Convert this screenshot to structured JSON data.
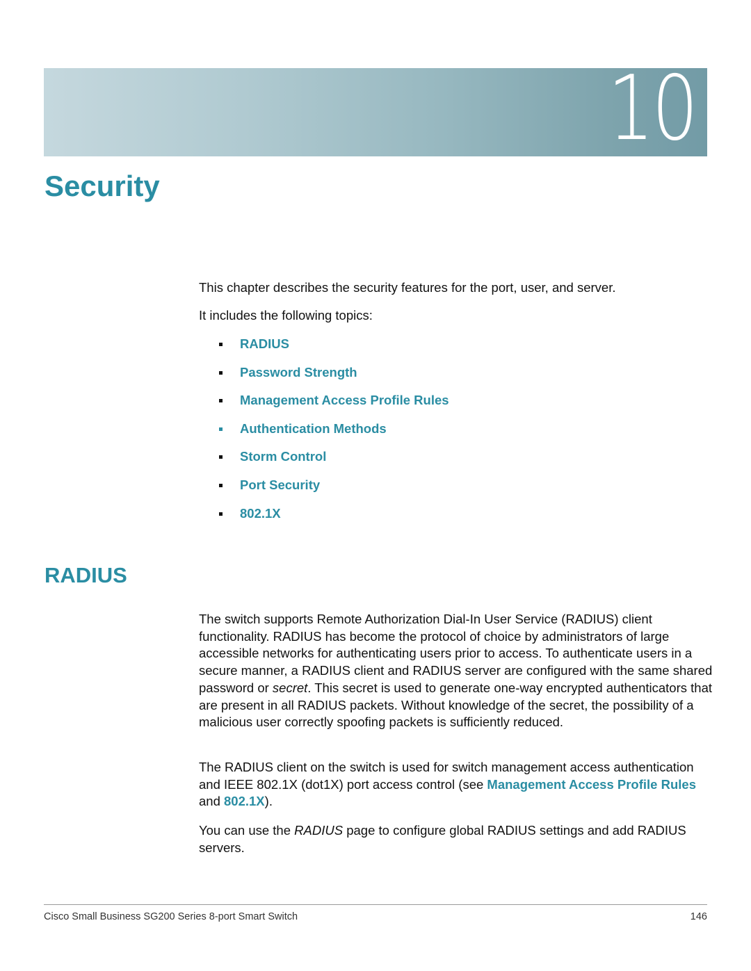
{
  "chapter": {
    "number": "10",
    "title": "Security"
  },
  "intro": {
    "line1": "This chapter describes the security features for the port, user, and server.",
    "line2": "It includes the following topics:"
  },
  "topics": [
    {
      "label": "RADIUS"
    },
    {
      "label": "Password Strength"
    },
    {
      "label": "Management Access Profile Rules"
    },
    {
      "label": "Authentication Methods"
    },
    {
      "label": "Storm Control"
    },
    {
      "label": "Port Security"
    },
    {
      "label": "802.1X"
    }
  ],
  "radius_section": {
    "heading": "RADIUS",
    "para1": {
      "before_italic": "The switch supports Remote Authorization Dial-In User Service (RADIUS) client functionality. RADIUS has become the protocol of choice by administrators of large accessible networks for authenticating users prior to access. To authenticate users in a secure manner, a RADIUS client and RADIUS server are configured with the same shared password or ",
      "italic": "secret",
      "after_italic": ". This secret is used to generate one-way encrypted authenticators that are present in all RADIUS packets. Without knowledge of the secret, the possibility of a malicious user correctly spoofing packets is sufficiently reduced."
    },
    "para2": {
      "before_link": "The RADIUS client on the switch is used for switch management access authentication and IEEE 802.1X (dot1X) port access control (see ",
      "link1": "Management Access Profile Rules",
      "between": " and ",
      "link2": "802.1X",
      "after": ")."
    },
    "para3": {
      "before_italic": "You can use the ",
      "italic": "RADIUS",
      "after_italic": " page to configure global RADIUS settings and add RADIUS servers."
    }
  },
  "footer": {
    "product": "Cisco Small Business SG200 Series 8-port Smart Switch",
    "page_number": "146"
  },
  "colors": {
    "accent": "#2a8da3",
    "banner_start": "#c5d8de",
    "banner_end": "#729ba6"
  }
}
